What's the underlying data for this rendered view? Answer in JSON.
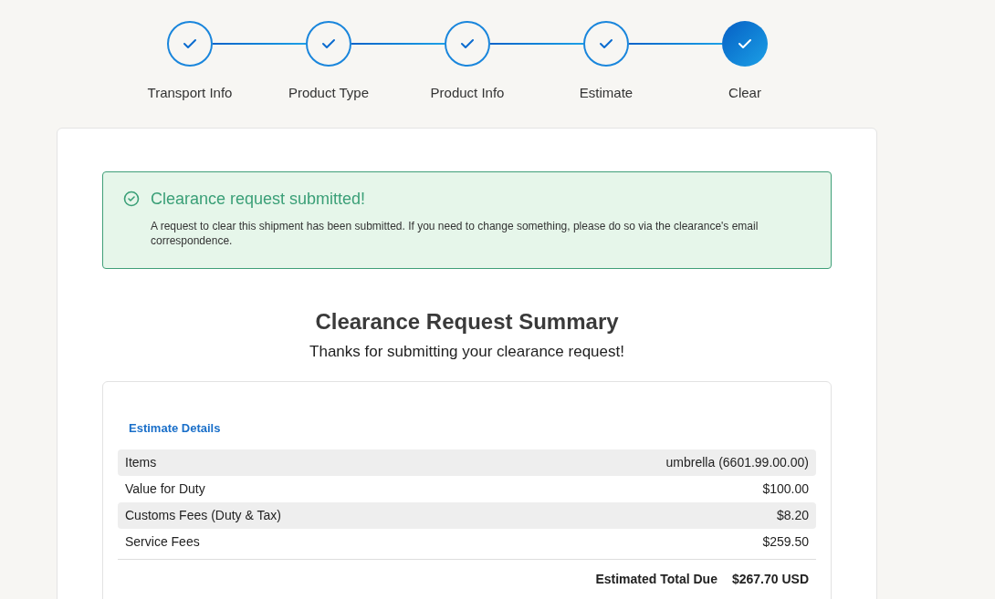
{
  "steps": [
    {
      "label": "Transport Info",
      "selected": false
    },
    {
      "label": "Product Type",
      "selected": false
    },
    {
      "label": "Product Info",
      "selected": false
    },
    {
      "label": "Estimate",
      "selected": false
    },
    {
      "label": "Clear",
      "selected": true
    }
  ],
  "alert": {
    "title": "Clearance request submitted!",
    "message": "A request to clear this shipment has been submitted. If you need to change something, please do so via the clearance's email correspondence."
  },
  "summary": {
    "title": "Clearance Request Summary",
    "subtitle": "Thanks for submitting your clearance request!"
  },
  "estimate": {
    "heading": "Estimate Details",
    "rows": [
      {
        "label": "Items",
        "value": "umbrella (6601.99.00.00)"
      },
      {
        "label": "Value for Duty",
        "value": "$100.00"
      },
      {
        "label": "Customs Fees (Duty & Tax)",
        "value": "$8.20"
      },
      {
        "label": "Service Fees",
        "value": "$259.50"
      }
    ],
    "total_label": "Estimated Total Due",
    "total_value": "$267.70 USD"
  }
}
